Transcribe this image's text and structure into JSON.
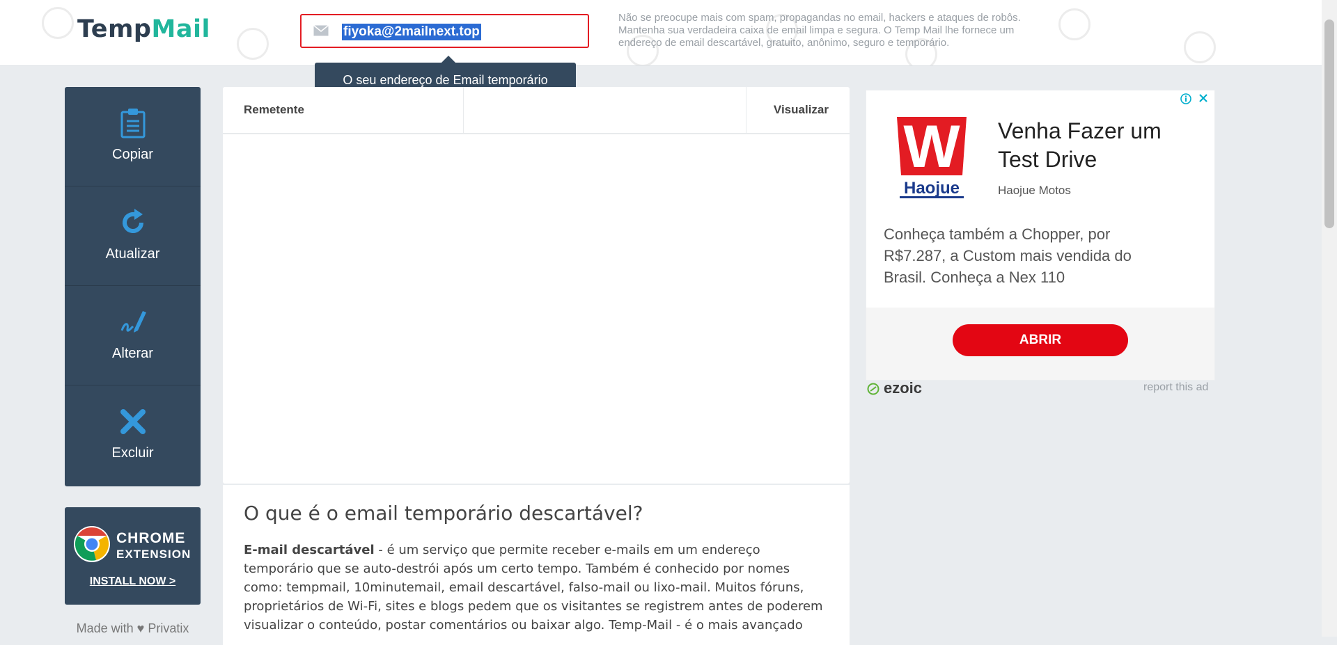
{
  "header": {
    "logo_part1": "Temp",
    "logo_part2": "Mail",
    "email": "fiyoka@2mailnext.top",
    "tooltip": "O seu endereço de Email temporário",
    "description": "Não se preocupe mais com spam, propagandas no email, hackers e ataques de robôs. Mantenha sua verdadeira caixa de email limpa e segura. O Temp Mail lhe fornece um endereço de email descartável, gratuito, anônimo, seguro e temporário."
  },
  "sidebar": {
    "items": [
      {
        "label": "Copiar",
        "icon": "clipboard-icon"
      },
      {
        "label": "Atualizar",
        "icon": "refresh-icon"
      },
      {
        "label": "Alterar",
        "icon": "edit-icon"
      },
      {
        "label": "Excluir",
        "icon": "delete-icon"
      }
    ]
  },
  "chrome_ext": {
    "title": "CHROME",
    "subtitle": "EXTENSION",
    "link": "INSTALL NOW >"
  },
  "made_with": "Made with ♥ Privatix",
  "inbox": {
    "col_sender": "Remetente",
    "col_view": "Visualizar"
  },
  "article": {
    "title": "O que é o email temporário descartável?",
    "bold_lead": "E-mail descartável",
    "body": " - é um serviço que permite receber e-mails em um endereço temporário que se auto-destrói após um certo tempo. Também é conhecido por nomes como: tempmail, 10minutemail, email descartável, falso-mail ou lixo-mail. Muitos fóruns, proprietários de Wi-Fi, sites e blogs pedem que os visitantes se registrem antes de poderem visualizar o conteúdo, postar comentários ou baixar algo. Temp-Mail - é o mais avançado"
  },
  "ad": {
    "title": "Venha Fazer um Test Drive",
    "brand": "Haojue Motos",
    "body": "Conheça também a Chopper, por R$7.287, a Custom mais vendida do Brasil. Conheça a Nex 110",
    "button": "ABRIR",
    "logo_text": "Haojue",
    "logo_letter": "W"
  },
  "ezoic": {
    "label": "ezoic",
    "report": "report this ad"
  },
  "colors": {
    "sidebar_bg": "#34495e",
    "accent_green": "#21b69c",
    "email_border": "#e31c23",
    "ad_button": "#e30613",
    "icon_blue": "#3498db"
  }
}
